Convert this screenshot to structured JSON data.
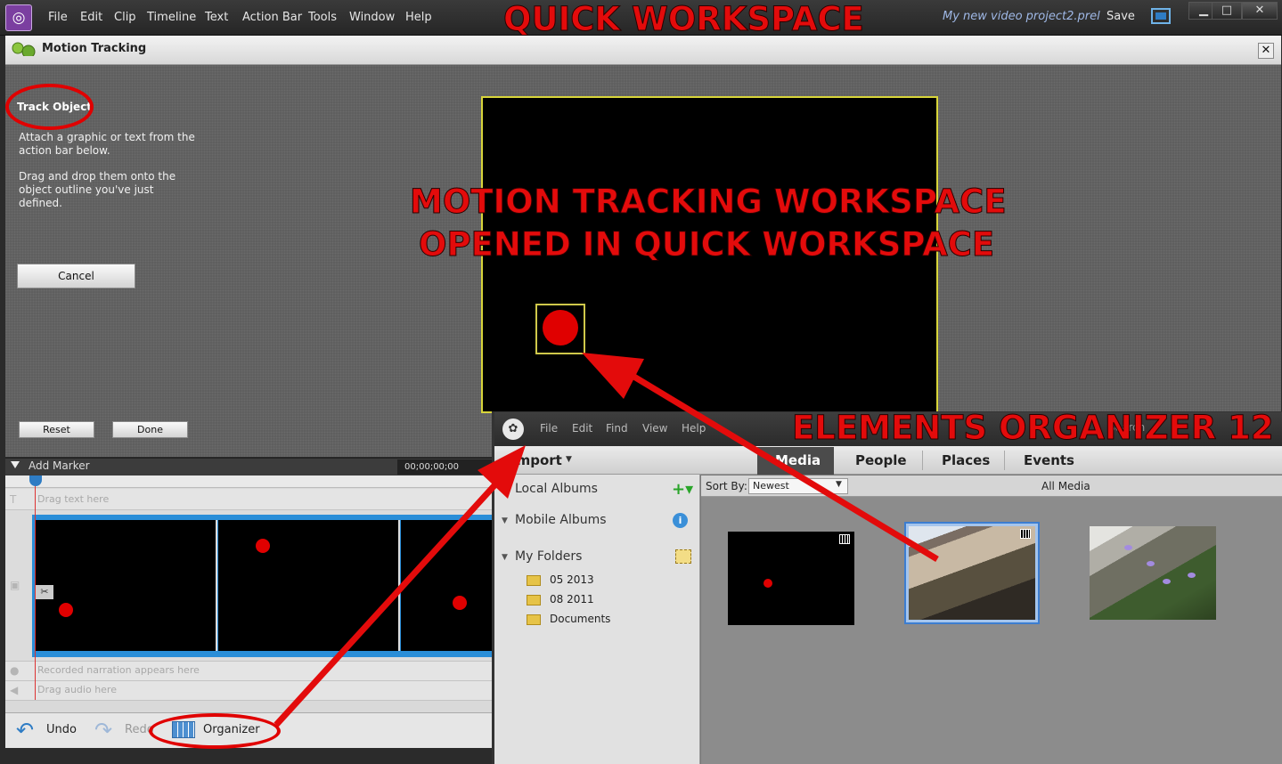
{
  "menubar": {
    "items": [
      "File",
      "Edit",
      "Clip",
      "Timeline",
      "Text",
      "Action Bar",
      "Tools",
      "Window",
      "Help"
    ],
    "project_name": "My new video project2.prel",
    "save_label": "Save"
  },
  "motion_tracking": {
    "title": "Motion Tracking",
    "track_object_title": "Track Object",
    "instruction_1": "Attach a graphic or text from the\naction bar below.",
    "instruction_2": "Drag and drop them onto the\nobject outline you've just\ndefined.",
    "cancel_label": "Cancel",
    "reset_label": "Reset",
    "done_label": "Done"
  },
  "timeline": {
    "add_marker_label": "Add Marker",
    "timecode": "00;00;00;00",
    "text_track_hint": "Drag text here",
    "narration_hint": "Recorded narration appears here",
    "audio_hint": "Drag audio here"
  },
  "bottom_bar": {
    "undo_label": "Undo",
    "redo_label": "Redo",
    "organizer_label": "Organizer"
  },
  "organizer": {
    "menu": [
      "File",
      "Edit",
      "Find",
      "View",
      "Help"
    ],
    "import_label": "Import",
    "tabs": [
      "Media",
      "People",
      "Places",
      "Events"
    ],
    "search_label": "Search",
    "sidebar": {
      "local_albums": "Local Albums",
      "mobile_albums": "Mobile Albums",
      "my_folders": "My Folders",
      "folders": [
        "05 2013",
        "08 2011",
        "Documents"
      ]
    },
    "sort_by_label": "Sort By:",
    "sort_value": "Newest",
    "all_media_label": "All Media"
  },
  "annotations": {
    "quick_workspace": "QUICK WORKSPACE",
    "motion_line_1": "MOTION TRACKING WORKSPACE",
    "motion_line_2": "OPENED IN QUICK WORKSPACE",
    "elements_organizer": "ELEMENTS ORGANIZER 12"
  },
  "colors": {
    "annotation_red": "#e30b0b",
    "selection_blue": "#3c7dd0",
    "track_outline": "#d8d53a"
  }
}
